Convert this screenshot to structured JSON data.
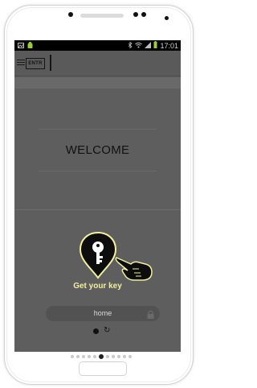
{
  "status_bar": {
    "time": "17:01"
  },
  "app": {
    "logo_text": "ENTR"
  },
  "main": {
    "welcome": "WELCOME",
    "cta_label": "Get your key",
    "location_value": "home"
  },
  "page_indicator": {
    "total": 11,
    "active": 5
  },
  "colors": {
    "accent": "#f3ef9a",
    "screen_bg": "#5e5e5e"
  }
}
